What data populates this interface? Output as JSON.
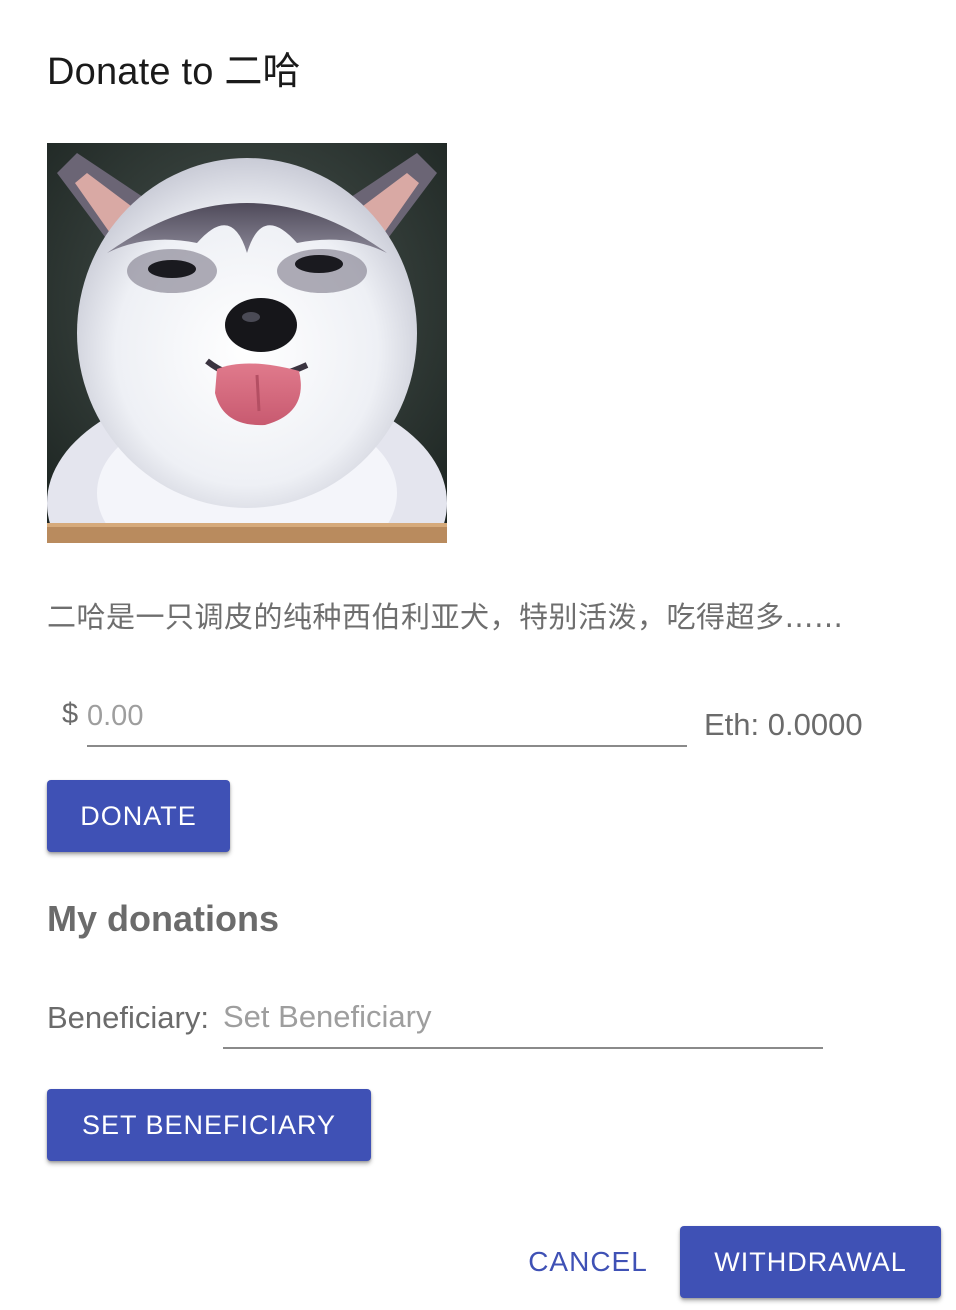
{
  "dialog": {
    "title": "Donate to 二哈"
  },
  "pet": {
    "image_icon": "husky-puppy-photo",
    "description": "二哈是一只调皮的纯种西伯利亚犬，特别活泼，吃得超多……"
  },
  "donation_form": {
    "currency_symbol": "$",
    "amount_value": "",
    "amount_placeholder": "0.00",
    "eth_label": "Eth: 0.0000",
    "donate_label": "DONATE"
  },
  "my_donations": {
    "heading": "My donations",
    "beneficiary_label": "Beneficiary:",
    "beneficiary_value": "",
    "beneficiary_placeholder": "Set Beneficiary",
    "set_beneficiary_label": "SET BENEFICIARY"
  },
  "actions": {
    "cancel_label": "CANCEL",
    "withdraw_label": "WITHDRAWAL"
  },
  "colors": {
    "primary": "#3f51b5",
    "secondary_text": "#6b6b6b",
    "placeholder": "#9e9e9e"
  }
}
